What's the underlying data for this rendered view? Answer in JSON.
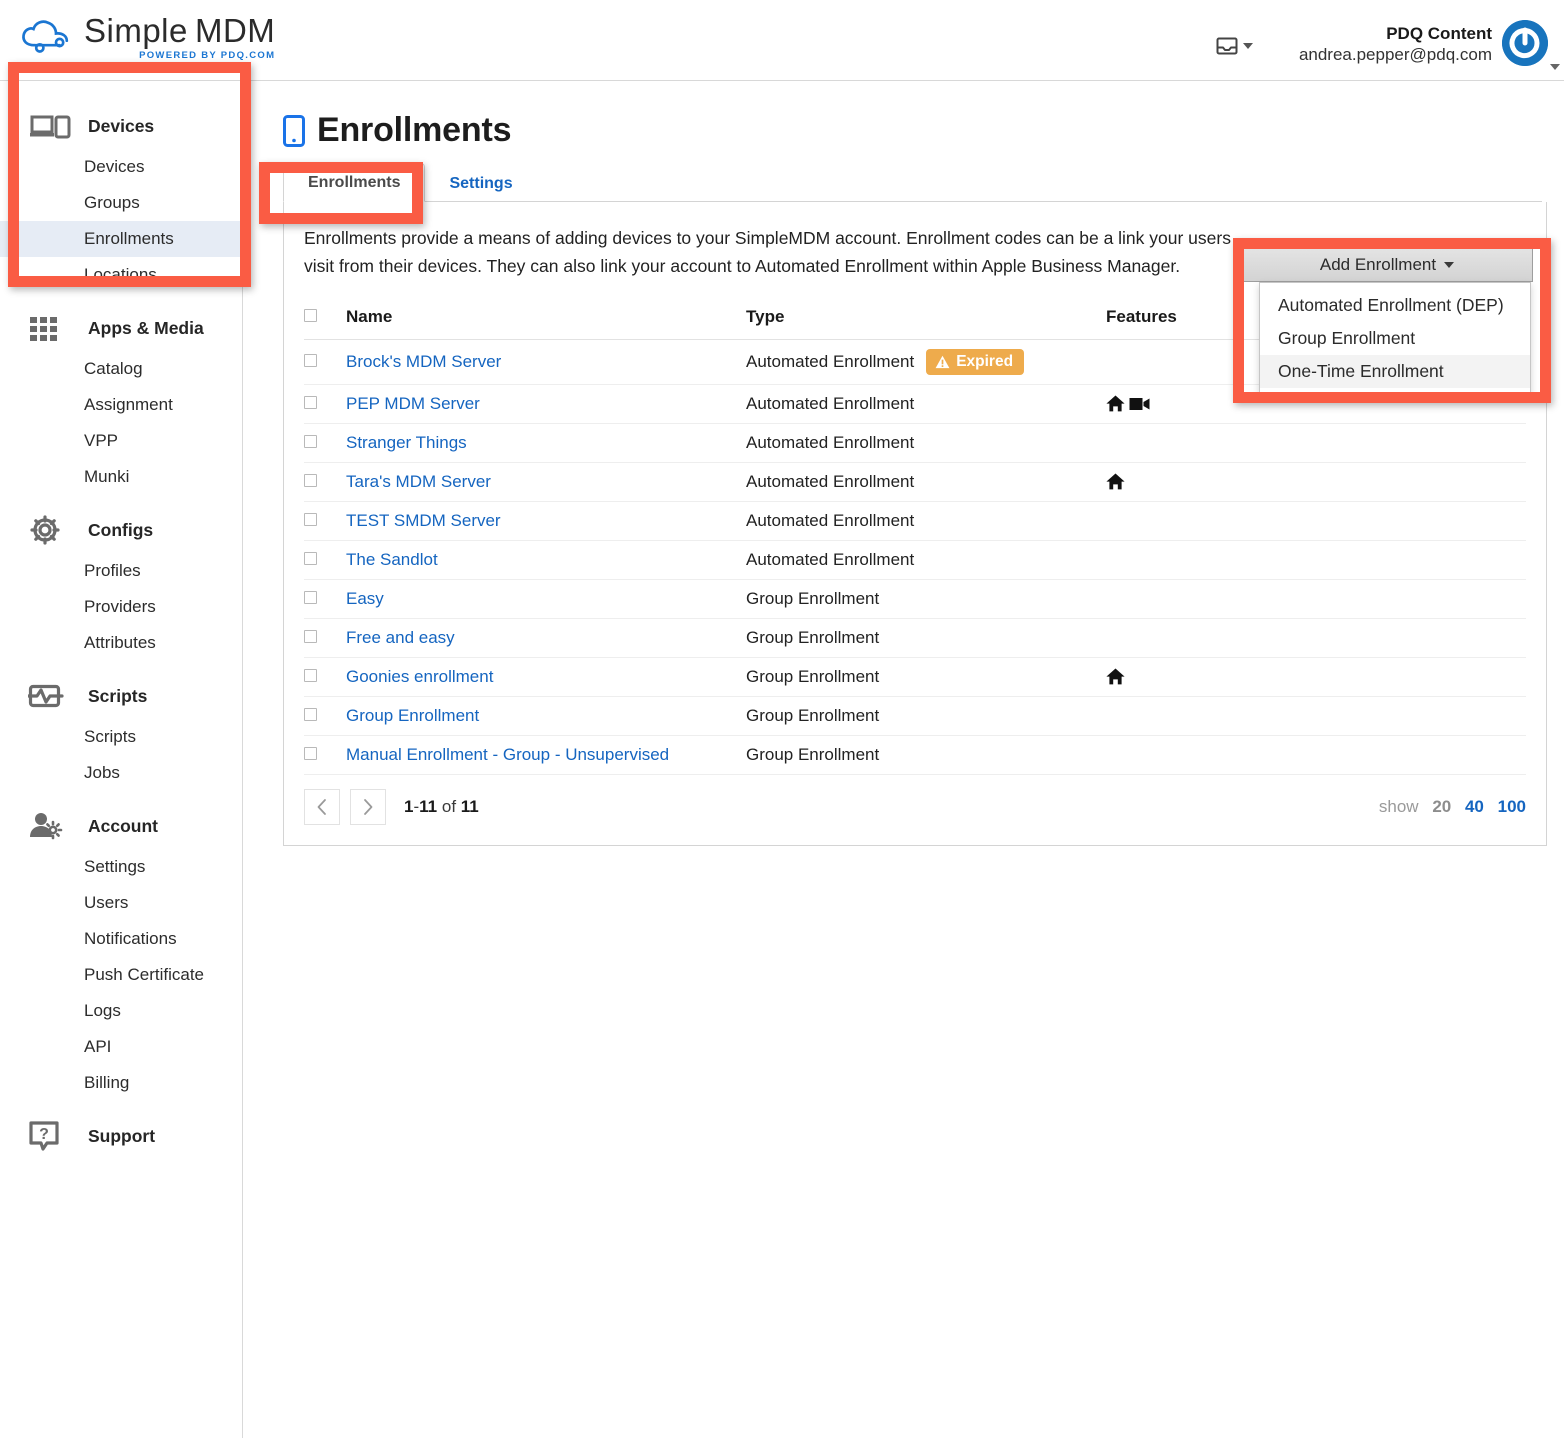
{
  "brand": {
    "name_simple": "Simple",
    "name_mdm": "MDM",
    "tagline": "POWERED BY PDQ.COM",
    "logo_icon": "cloud-icon",
    "accent_blue": "#1b76d2"
  },
  "header": {
    "inbox_icon": "inbox-icon",
    "inbox_caret_icon": "chevron-down-icon",
    "account_name": "PDQ Content",
    "account_email": "andrea.pepper@pdq.com",
    "avatar_icon": "pdq-logo-avatar",
    "avatar_caret_icon": "chevron-down-icon"
  },
  "sidebar": {
    "groups": [
      {
        "label": "Devices",
        "icon": "devices-icon",
        "items": [
          {
            "label": "Devices",
            "active": false
          },
          {
            "label": "Groups",
            "active": false
          },
          {
            "label": "Enrollments",
            "active": true
          },
          {
            "label": "Locations",
            "active": false
          }
        ]
      },
      {
        "label": "Apps & Media",
        "icon": "apps-grid-icon",
        "items": [
          {
            "label": "Catalog",
            "active": false
          },
          {
            "label": "Assignment",
            "active": false
          },
          {
            "label": "VPP",
            "active": false
          },
          {
            "label": "Munki",
            "active": false
          }
        ]
      },
      {
        "label": "Configs",
        "icon": "gear-icon",
        "items": [
          {
            "label": "Profiles",
            "active": false
          },
          {
            "label": "Providers",
            "active": false
          },
          {
            "label": "Attributes",
            "active": false
          }
        ]
      },
      {
        "label": "Scripts",
        "icon": "script-pulse-icon",
        "items": [
          {
            "label": "Scripts",
            "active": false
          },
          {
            "label": "Jobs",
            "active": false
          }
        ]
      },
      {
        "label": "Account",
        "icon": "user-gear-icon",
        "items": [
          {
            "label": "Settings",
            "active": false
          },
          {
            "label": "Users",
            "active": false
          },
          {
            "label": "Notifications",
            "active": false
          },
          {
            "label": "Push Certificate",
            "active": false
          },
          {
            "label": "Logs",
            "active": false
          },
          {
            "label": "API",
            "active": false
          },
          {
            "label": "Billing",
            "active": false
          }
        ]
      },
      {
        "label": "Support",
        "icon": "question-help-icon",
        "items": []
      }
    ]
  },
  "page": {
    "title": "Enrollments",
    "title_icon": "mobile-device-icon",
    "tabs": [
      {
        "label": "Enrollments",
        "active": true
      },
      {
        "label": "Settings",
        "active": false
      }
    ],
    "intro": "Enrollments provide a means of adding devices to your SimpleMDM account. Enrollment codes can be a link your users visit from their devices. They can also link your account to Automated Enrollment within Apple Business Manager."
  },
  "add_enrollment": {
    "button_label": "Add Enrollment",
    "caret_icon": "caret-down-icon",
    "open": true,
    "options": [
      {
        "label": "Automated Enrollment (DEP)",
        "hovered": false
      },
      {
        "label": "Group Enrollment",
        "hovered": false
      },
      {
        "label": "One-Time Enrollment",
        "hovered": true
      }
    ]
  },
  "table": {
    "columns": [
      "Name",
      "Type",
      "Features"
    ],
    "rows": [
      {
        "name": "Brock's MDM Server",
        "type": "Automated Enrollment",
        "badge": "Expired",
        "badge_icon": "warning-triangle-icon",
        "features": []
      },
      {
        "name": "PEP MDM Server",
        "type": "Automated Enrollment",
        "badge": "",
        "features": [
          "home-icon",
          "video-camera-icon"
        ]
      },
      {
        "name": "Stranger Things",
        "type": "Automated Enrollment",
        "badge": "",
        "features": []
      },
      {
        "name": "Tara's MDM Server",
        "type": "Automated Enrollment",
        "badge": "",
        "features": [
          "home-icon"
        ]
      },
      {
        "name": "TEST SMDM Server",
        "type": "Automated Enrollment",
        "badge": "",
        "features": []
      },
      {
        "name": "The Sandlot",
        "type": "Automated Enrollment",
        "badge": "",
        "features": []
      },
      {
        "name": "Easy",
        "type": "Group Enrollment",
        "badge": "",
        "features": []
      },
      {
        "name": "Free and easy",
        "type": "Group Enrollment",
        "badge": "",
        "features": []
      },
      {
        "name": "Goonies enrollment",
        "type": "Group Enrollment",
        "badge": "",
        "features": [
          "home-icon"
        ]
      },
      {
        "name": "Group Enrollment",
        "type": "Group Enrollment",
        "badge": "",
        "features": []
      },
      {
        "name": "Manual Enrollment - Group - Unsupervised",
        "type": "Group Enrollment",
        "badge": "",
        "features": []
      }
    ]
  },
  "pagination": {
    "prev_icon": "chevron-left-icon",
    "next_icon": "chevron-right-icon",
    "range_start": "1",
    "range_sep": "-",
    "range_end": "11",
    "of_word": "of",
    "total": "11",
    "show_label": "show",
    "sizes": [
      {
        "label": "20",
        "current": true
      },
      {
        "label": "40",
        "current": false
      },
      {
        "label": "100",
        "current": false
      }
    ]
  },
  "annotations": {
    "highlight_color": "#fa5c44",
    "boxes": [
      "sidebar-devices-section",
      "enrollments-tab",
      "add-enrollment-dropdown"
    ]
  }
}
